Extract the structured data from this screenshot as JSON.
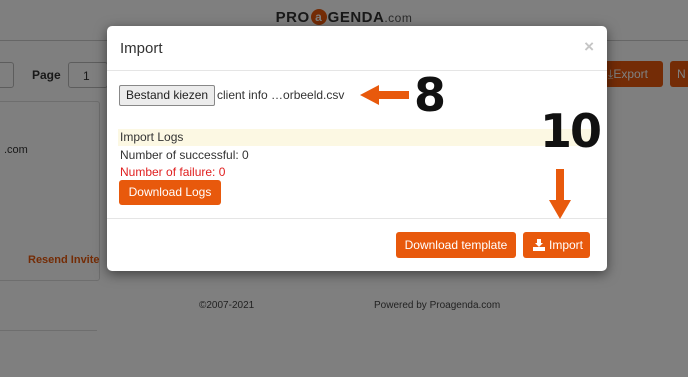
{
  "background": {
    "brand": {
      "left": "PRO",
      "at": "a",
      "right": "GENDA",
      "domain": ".com"
    },
    "page_label": "Page",
    "page_value": "1",
    "export_label": "Export",
    "next_label": "N",
    "email_fragment": ".com",
    "resend_label": "Resend Invite",
    "copyright": "©2007-2021",
    "powered_by": "Powered by Proagenda.com"
  },
  "modal": {
    "title": "Import",
    "close_symbol": "×",
    "file_button_label": "Bestand kiezen",
    "file_name": "client info …orbeeld.csv",
    "logs_title": "Import Logs",
    "success_text": "Number of successful: 0",
    "failure_text": "Number of failure: 0",
    "download_logs_label": "Download Logs",
    "download_template_label": "Download template",
    "import_label": "Import"
  },
  "annotations": {
    "step_a": "8",
    "step_b": "10",
    "arrow_color": "#e8590c"
  },
  "colors": {
    "accent": "#e8590c",
    "failure": "#e02020",
    "logs_band": "#fcf8e3"
  }
}
